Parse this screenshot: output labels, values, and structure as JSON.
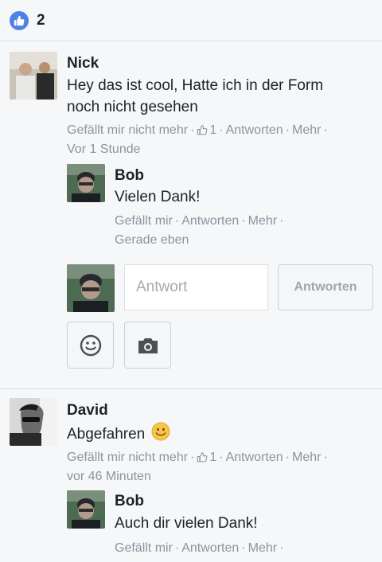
{
  "likes": {
    "count": "2"
  },
  "comments": [
    {
      "author": "Nick",
      "text_line1": "Hey das ist cool, Hatte ich in der Form",
      "text_line2": "noch nicht gesehen",
      "actions": {
        "like": "Gefällt mir nicht mehr",
        "like_count": "1",
        "reply": "Antworten",
        "more": "Mehr"
      },
      "time": "Vor 1 Stunde",
      "reply": {
        "author": "Bob",
        "text": "Vielen Dank!",
        "actions": {
          "like": "Gefällt mir",
          "reply": "Antworten",
          "more": "Mehr"
        },
        "time": "Gerade eben"
      }
    },
    {
      "author": "David",
      "text": "Abgefahren",
      "emoji": "🙂",
      "actions": {
        "like": "Gefällt mir nicht mehr",
        "like_count": "1",
        "reply": "Antworten",
        "more": "Mehr"
      },
      "time": "vor 46 Minuten",
      "reply": {
        "author": "Bob",
        "text": "Auch dir vielen Dank!",
        "actions": {
          "like": "Gefällt mir",
          "reply": "Antworten",
          "more": "Mehr"
        }
      }
    }
  ],
  "reply_box": {
    "placeholder": "Antwort",
    "submit_label": "Antworten"
  },
  "colors": {
    "accent": "#4f81e8",
    "meta": "#8d949e",
    "border": "#dddfe2",
    "icon": "#4b4f56"
  }
}
